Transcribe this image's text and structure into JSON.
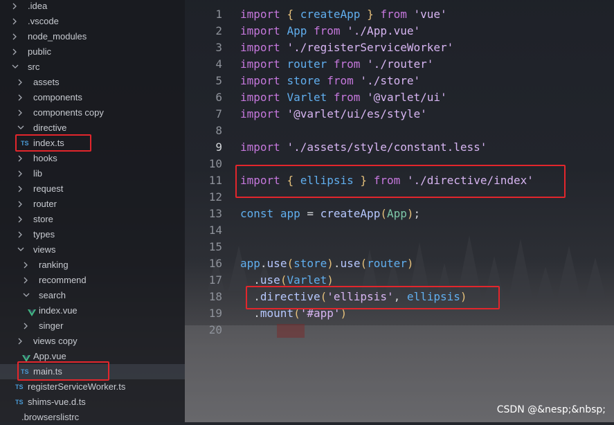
{
  "explorer": {
    "items": [
      {
        "label": ".idea",
        "type": "folder",
        "expanded": false
      },
      {
        "label": ".vscode",
        "type": "folder",
        "expanded": false
      },
      {
        "label": "node_modules",
        "type": "folder",
        "expanded": false
      },
      {
        "label": "public",
        "type": "folder",
        "expanded": false
      },
      {
        "label": "src",
        "type": "folder",
        "expanded": true
      },
      {
        "label": "assets",
        "type": "folder",
        "expanded": false
      },
      {
        "label": "components",
        "type": "folder",
        "expanded": false
      },
      {
        "label": "components copy",
        "type": "folder",
        "expanded": false
      },
      {
        "label": "directive",
        "type": "folder",
        "expanded": true
      },
      {
        "label": "index.ts",
        "type": "ts"
      },
      {
        "label": "hooks",
        "type": "folder",
        "expanded": false
      },
      {
        "label": "lib",
        "type": "folder",
        "expanded": false
      },
      {
        "label": "request",
        "type": "folder",
        "expanded": false
      },
      {
        "label": "router",
        "type": "folder",
        "expanded": false
      },
      {
        "label": "store",
        "type": "folder",
        "expanded": false
      },
      {
        "label": "types",
        "type": "folder",
        "expanded": false
      },
      {
        "label": "views",
        "type": "folder",
        "expanded": true
      },
      {
        "label": "ranking",
        "type": "folder",
        "expanded": false
      },
      {
        "label": "recommend",
        "type": "folder",
        "expanded": false
      },
      {
        "label": "search",
        "type": "folder",
        "expanded": true
      },
      {
        "label": "index.vue",
        "type": "vue"
      },
      {
        "label": "singer",
        "type": "folder",
        "expanded": false
      },
      {
        "label": "views copy",
        "type": "folder",
        "expanded": false
      },
      {
        "label": "App.vue",
        "type": "vue"
      },
      {
        "label": "main.ts",
        "type": "ts",
        "selected": true
      },
      {
        "label": "registerServiceWorker.ts",
        "type": "ts"
      },
      {
        "label": "shims-vue.d.ts",
        "type": "ts"
      },
      {
        "label": ".browserslistrc",
        "type": "file"
      }
    ],
    "ts_badge": "TS"
  },
  "editor": {
    "lines": [
      {
        "n": "1",
        "tokens": [
          [
            "kw",
            "import"
          ],
          [
            "pl",
            " "
          ],
          [
            "br",
            "{"
          ],
          [
            "pl",
            " "
          ],
          [
            "var",
            "createApp"
          ],
          [
            "pl",
            " "
          ],
          [
            "br",
            "}"
          ],
          [
            "pl",
            " "
          ],
          [
            "kw",
            "from"
          ],
          [
            "pl",
            " "
          ],
          [
            "str",
            "'vue'"
          ]
        ]
      },
      {
        "n": "2",
        "tokens": [
          [
            "kw",
            "import"
          ],
          [
            "pl",
            " "
          ],
          [
            "var",
            "App"
          ],
          [
            "pl",
            " "
          ],
          [
            "kw",
            "from"
          ],
          [
            "pl",
            " "
          ],
          [
            "str",
            "'./App.vue'"
          ]
        ]
      },
      {
        "n": "3",
        "tokens": [
          [
            "kw",
            "import"
          ],
          [
            "pl",
            " "
          ],
          [
            "str",
            "'./registerServiceWorker'"
          ]
        ]
      },
      {
        "n": "4",
        "tokens": [
          [
            "kw",
            "import"
          ],
          [
            "pl",
            " "
          ],
          [
            "var",
            "router"
          ],
          [
            "pl",
            " "
          ],
          [
            "kw",
            "from"
          ],
          [
            "pl",
            " "
          ],
          [
            "str",
            "'./router'"
          ]
        ]
      },
      {
        "n": "5",
        "tokens": [
          [
            "kw",
            "import"
          ],
          [
            "pl",
            " "
          ],
          [
            "var",
            "store"
          ],
          [
            "pl",
            " "
          ],
          [
            "kw",
            "from"
          ],
          [
            "pl",
            " "
          ],
          [
            "str",
            "'./store'"
          ]
        ]
      },
      {
        "n": "6",
        "tokens": [
          [
            "kw",
            "import"
          ],
          [
            "pl",
            " "
          ],
          [
            "var",
            "Varlet"
          ],
          [
            "pl",
            " "
          ],
          [
            "kw",
            "from"
          ],
          [
            "pl",
            " "
          ],
          [
            "str",
            "'@varlet/ui'"
          ]
        ]
      },
      {
        "n": "7",
        "tokens": [
          [
            "kw",
            "import"
          ],
          [
            "pl",
            " "
          ],
          [
            "str",
            "'@varlet/ui/es/style'"
          ]
        ]
      },
      {
        "n": "8",
        "tokens": []
      },
      {
        "n": "9",
        "tokens": [
          [
            "kw",
            "import"
          ],
          [
            "pl",
            " "
          ],
          [
            "str",
            "'./assets/style/constant.less'"
          ]
        ]
      },
      {
        "n": "10",
        "tokens": []
      },
      {
        "n": "11",
        "tokens": [
          [
            "kw",
            "import"
          ],
          [
            "pl",
            " "
          ],
          [
            "br",
            "{"
          ],
          [
            "pl",
            " "
          ],
          [
            "var",
            "ellipsis"
          ],
          [
            "pl",
            " "
          ],
          [
            "br",
            "}"
          ],
          [
            "pl",
            " "
          ],
          [
            "kw",
            "from"
          ],
          [
            "pl",
            " "
          ],
          [
            "str",
            "'./directive/index'"
          ]
        ]
      },
      {
        "n": "12",
        "tokens": []
      },
      {
        "n": "13",
        "tokens": [
          [
            "kw2",
            "const"
          ],
          [
            "pl",
            " "
          ],
          [
            "var",
            "app"
          ],
          [
            "pl",
            " = "
          ],
          [
            "fn",
            "createApp"
          ],
          [
            "br",
            "("
          ],
          [
            "cls",
            "App"
          ],
          [
            "br",
            ")"
          ],
          [
            "pl",
            ";"
          ]
        ]
      },
      {
        "n": "14",
        "tokens": []
      },
      {
        "n": "15",
        "tokens": []
      },
      {
        "n": "16",
        "tokens": [
          [
            "var",
            "app"
          ],
          [
            "pl",
            "."
          ],
          [
            "fn",
            "use"
          ],
          [
            "br",
            "("
          ],
          [
            "var",
            "store"
          ],
          [
            "br",
            ")"
          ],
          [
            "pl",
            "."
          ],
          [
            "fn",
            "use"
          ],
          [
            "br",
            "("
          ],
          [
            "var",
            "router"
          ],
          [
            "br",
            ")"
          ]
        ]
      },
      {
        "n": "17",
        "tokens": [
          [
            "pl",
            "  ."
          ],
          [
            "fn",
            "use"
          ],
          [
            "br",
            "("
          ],
          [
            "var",
            "Varlet"
          ],
          [
            "br",
            ")"
          ]
        ]
      },
      {
        "n": "18",
        "tokens": [
          [
            "pl",
            "  ."
          ],
          [
            "fn",
            "directive"
          ],
          [
            "br",
            "("
          ],
          [
            "str",
            "'ellipsis'"
          ],
          [
            "pl",
            ", "
          ],
          [
            "var",
            "ellipsis"
          ],
          [
            "br",
            ")"
          ]
        ]
      },
      {
        "n": "19",
        "tokens": [
          [
            "pl",
            "  ."
          ],
          [
            "fn",
            "mount"
          ],
          [
            "br",
            "("
          ],
          [
            "str",
            "'#app'"
          ],
          [
            "br",
            ")"
          ]
        ]
      },
      {
        "n": "20",
        "tokens": []
      }
    ]
  },
  "watermark": "CSDN @&nesp;&nbsp;",
  "colors": {
    "highlight_box": "#e3262c",
    "keyword": "#c678dd",
    "string": "#d7b5f2",
    "identifier": "#61afef",
    "ts_badge": "#4a9bd6",
    "vue_icon": "#41b883"
  }
}
